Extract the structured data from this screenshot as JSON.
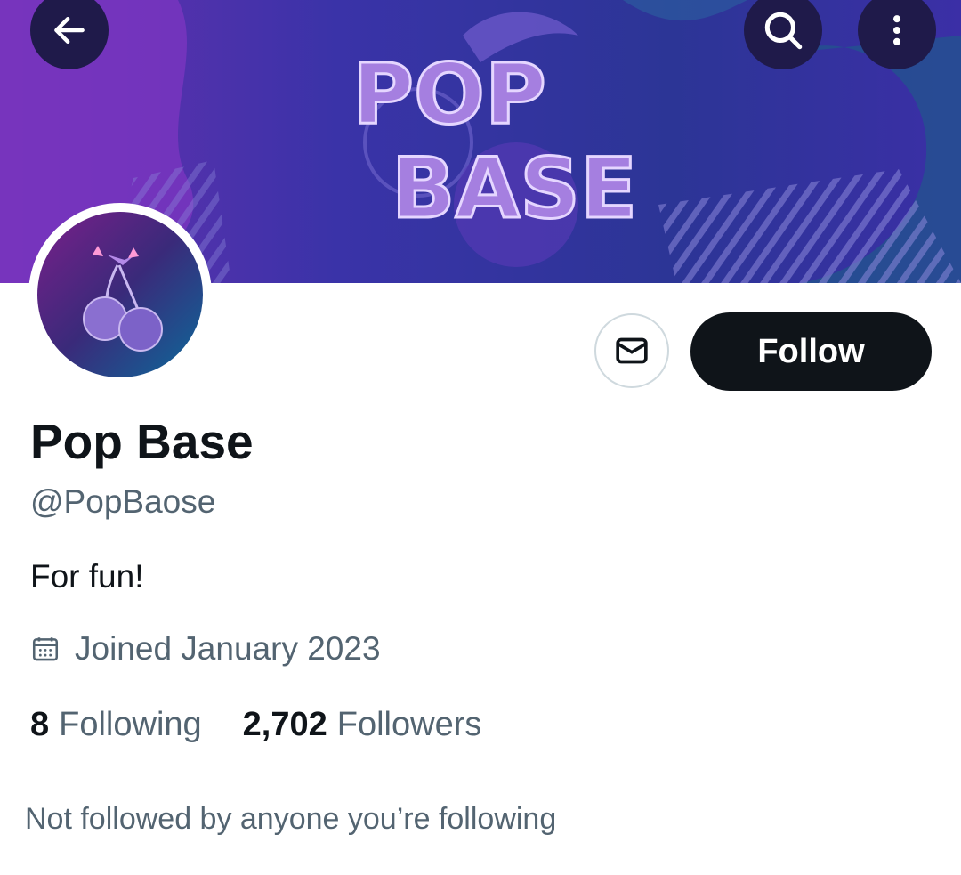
{
  "banner": {
    "logo_line1": "POP",
    "logo_line2": "BASE"
  },
  "nav": {
    "back_icon": "arrow-left-icon",
    "search_icon": "search-icon",
    "more_icon": "more-vertical-icon"
  },
  "profile": {
    "name": "Pop Base",
    "handle": "@PopBaose",
    "bio": "For fun!",
    "joined": "Joined January 2023",
    "following_count": "8",
    "following_label": "Following",
    "followers_count": "2,702",
    "followers_label": "Followers",
    "social_context": "Not followed by anyone you’re following"
  },
  "actions": {
    "follow_label": "Follow",
    "message_icon": "envelope-icon"
  },
  "colors": {
    "accent_dark": "#0f1419",
    "muted_text": "#536471",
    "banner_purple": "#2f2f9c"
  }
}
